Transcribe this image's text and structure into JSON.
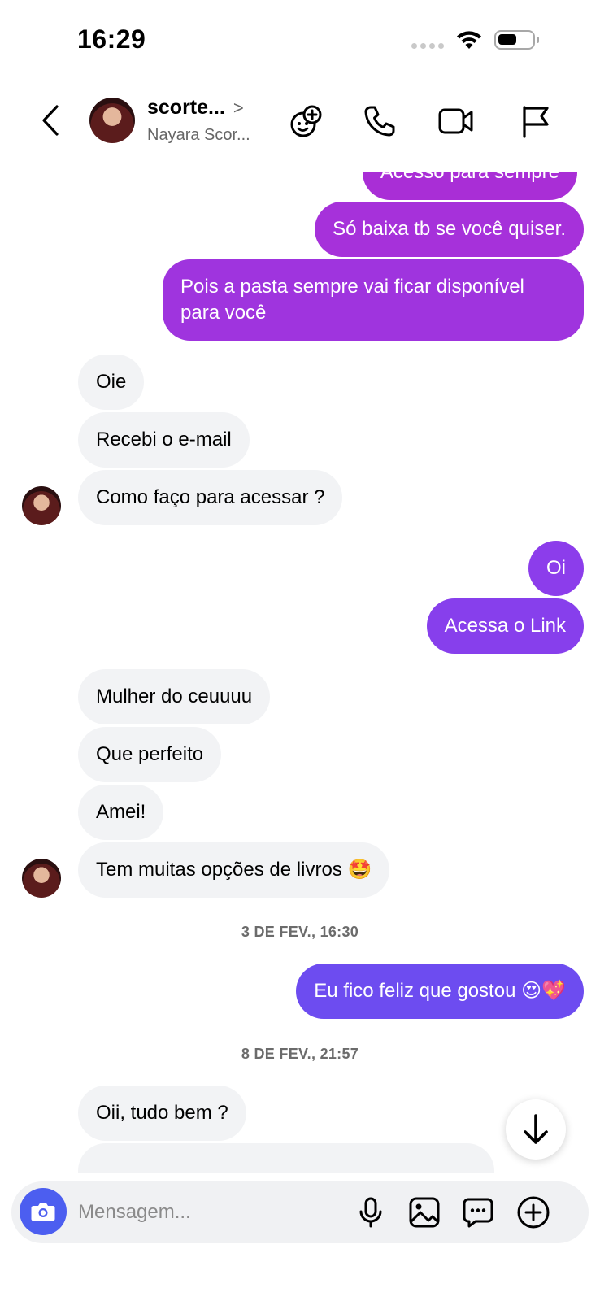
{
  "status_bar": {
    "time": "16:29"
  },
  "header": {
    "name": "scorte...",
    "subtitle": "Nayara Scor...",
    "chevron": ">"
  },
  "messages": [
    {
      "from": "me",
      "text": "Acesso para sempre"
    },
    {
      "from": "me",
      "text": "Só baixa tb se você quiser."
    },
    {
      "from": "me",
      "text": "Pois a pasta sempre vai ficar disponível para você"
    },
    {
      "from": "them",
      "text": "Oie"
    },
    {
      "from": "them",
      "text": "Recebi o e-mail"
    },
    {
      "from": "them",
      "text": "Como faço para acessar ?"
    },
    {
      "from": "me",
      "text": "Oi"
    },
    {
      "from": "me",
      "text": "Acessa o Link"
    },
    {
      "from": "them",
      "text": "Mulher do ceuuuu"
    },
    {
      "from": "them",
      "text": "Que perfeito"
    },
    {
      "from": "them",
      "text": "Amei!"
    },
    {
      "from": "them",
      "text": "Tem muitas opções de livros 🤩"
    },
    {
      "from": "me",
      "text": "Eu fico feliz que gostou 😍💖"
    },
    {
      "from": "them",
      "text": "Oii, tudo bem ?"
    }
  ],
  "timestamps": [
    "3 DE FEV., 16:30",
    "8 DE FEV., 21:57"
  ],
  "composer": {
    "placeholder": "Mensagem..."
  },
  "colors": {
    "outgoing_bubble_top": "#a431dc",
    "outgoing_bubble_mid": "#8a3ee8",
    "outgoing_bubble_bottom": "#6d4cf0",
    "incoming_bubble": "#f2f3f5",
    "camera_button": "#4c5ef0"
  },
  "icons": {
    "back": "chevron-left-icon",
    "games": "add-effect-icon",
    "call": "phone-icon",
    "video": "video-camera-icon",
    "report": "flag-icon",
    "camera": "camera-icon",
    "mic": "microphone-icon",
    "gallery": "image-icon",
    "sticker": "chat-bubble-icon",
    "more": "plus-circle-icon",
    "scroll": "arrow-down-icon"
  }
}
